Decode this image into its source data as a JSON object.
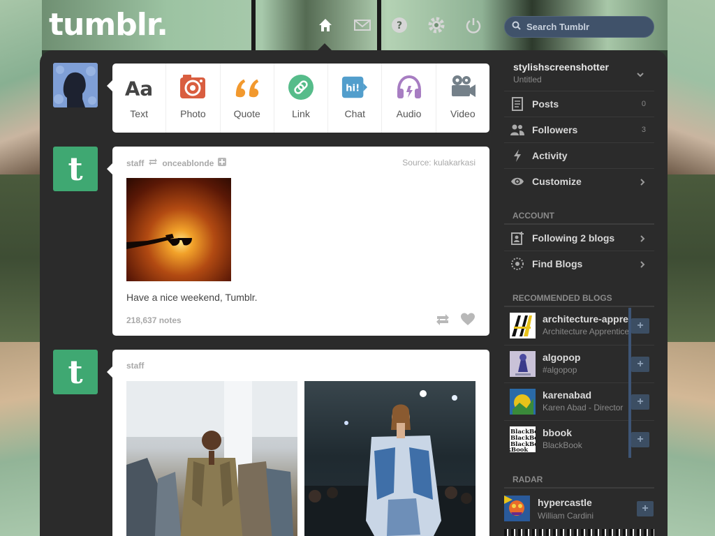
{
  "header": {
    "logo": "tumblr.",
    "search_placeholder": "Search Tumblr"
  },
  "post_types": [
    {
      "label": "Text",
      "icon": "text-icon",
      "color": "#444444"
    },
    {
      "label": "Photo",
      "icon": "camera-icon",
      "color": "#d95e40"
    },
    {
      "label": "Quote",
      "icon": "quote-icon",
      "color": "#f2992e"
    },
    {
      "label": "Link",
      "icon": "link-icon",
      "color": "#56bc8a"
    },
    {
      "label": "Chat",
      "icon": "chat-icon",
      "color": "#529ecc"
    },
    {
      "label": "Audio",
      "icon": "headphones-icon",
      "color": "#a77dc2"
    },
    {
      "label": "Video",
      "icon": "video-camera-icon",
      "color": "#748089"
    }
  ],
  "posts": [
    {
      "author": "staff",
      "reblogged_from": "onceablonde",
      "source_label": "Source:",
      "source": "kulakarkasi",
      "caption": "Have a nice weekend, Tumblr.",
      "notes": "218,637 notes"
    },
    {
      "author": "staff"
    }
  ],
  "sidebar": {
    "blog_name": "stylishscreenshotter",
    "blog_title": "Untitled",
    "items": [
      {
        "label": "Posts",
        "count": "0",
        "icon": "document-icon"
      },
      {
        "label": "Followers",
        "count": "3",
        "icon": "people-icon"
      },
      {
        "label": "Activity",
        "count": "",
        "icon": "lightning-icon"
      },
      {
        "label": "Customize",
        "count": "",
        "icon": "eye-icon"
      }
    ],
    "account_heading": "ACCOUNT",
    "account_items": [
      {
        "label": "Following 2 blogs",
        "icon": "add-person-icon"
      },
      {
        "label": "Find Blogs",
        "icon": "compass-icon"
      }
    ],
    "recommended_heading": "RECOMMENDED BLOGS",
    "recommended": [
      {
        "name": "architecture-apprentice",
        "subtitle": "Architecture Apprentice"
      },
      {
        "name": "algopop",
        "subtitle": "#algopop"
      },
      {
        "name": "karenabad",
        "subtitle": "Karen Abad - Director"
      },
      {
        "name": "bbook",
        "subtitle": "BlackBook"
      }
    ],
    "radar_heading": "RADAR",
    "radar": {
      "name": "hypercastle",
      "subtitle": "William Cardini"
    }
  },
  "colors": {
    "dashboard_bg": "#2b2b2b",
    "staff_avatar": "#3fa872",
    "search_bg": "#40526a"
  }
}
